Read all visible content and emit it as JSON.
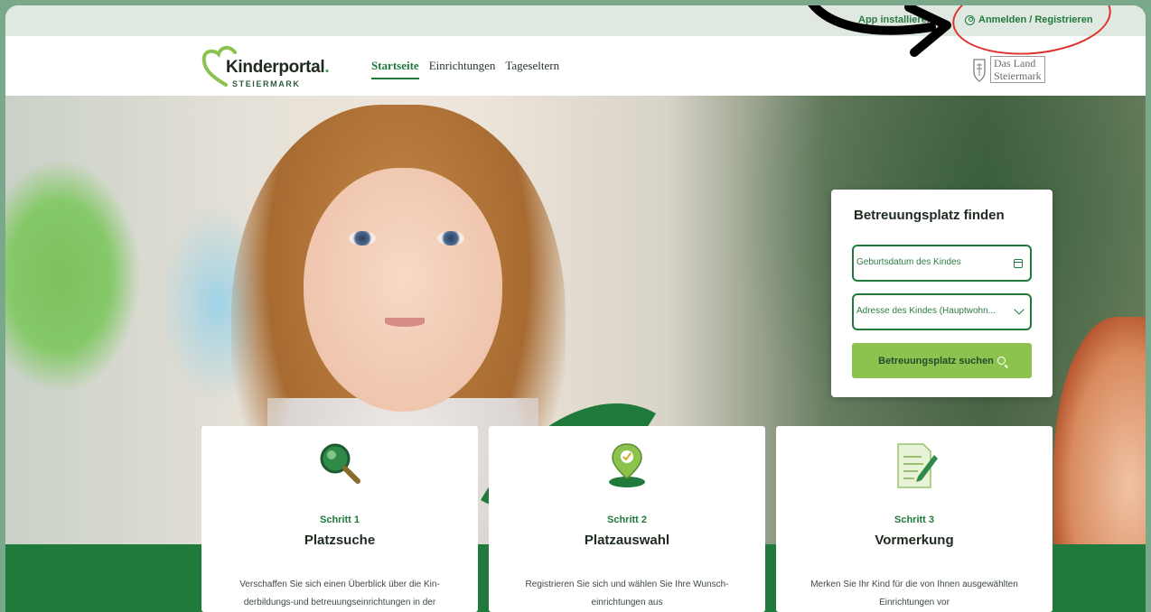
{
  "topbar": {
    "app_label": "App installieren",
    "login_label": "Anmelden / Registrieren"
  },
  "header": {
    "logo_name": "Kinderportal",
    "logo_dot": ".",
    "logo_sub": "STEIERMARK",
    "nav": [
      {
        "label": "Startseite",
        "active": true
      },
      {
        "label": "Einrichtungen",
        "active": false
      },
      {
        "label": "Tageseltern",
        "active": false
      }
    ],
    "land_line1": "Das Land",
    "land_line2": "Steiermark"
  },
  "search": {
    "title": "Betreuungsplatz finden",
    "birthdate_placeholder": "Geburtsdatum des Kindes",
    "address_placeholder": "Adresse des Kindes (Hauptwohn...",
    "button_label": "Betreuungsplatz suchen"
  },
  "steps": [
    {
      "number": "Schritt 1",
      "title": "Platzsuche",
      "icon": "magnifier-icon",
      "desc_1": "Verschaffen Sie sich einen Überblick über die Kin-",
      "desc_2": "derbildungs-und betreuungseinrichtungen in der"
    },
    {
      "number": "Schritt 2",
      "title": "Platzauswahl",
      "icon": "location-pin-icon",
      "desc_1": "Registrieren Sie sich und wählen Sie Ihre Wunsch-",
      "desc_2": "einrichtungen aus"
    },
    {
      "number": "Schritt 3",
      "title": "Vormerkung",
      "icon": "document-pen-icon",
      "desc_1": "Merken Sie Ihr Kind für die von Ihnen ausgewählten",
      "desc_2": "Einrichtungen vor"
    }
  ],
  "colors": {
    "brand_green": "#1f7a3c",
    "button_green": "#8cc34f",
    "annotation_red": "#e0302c"
  }
}
